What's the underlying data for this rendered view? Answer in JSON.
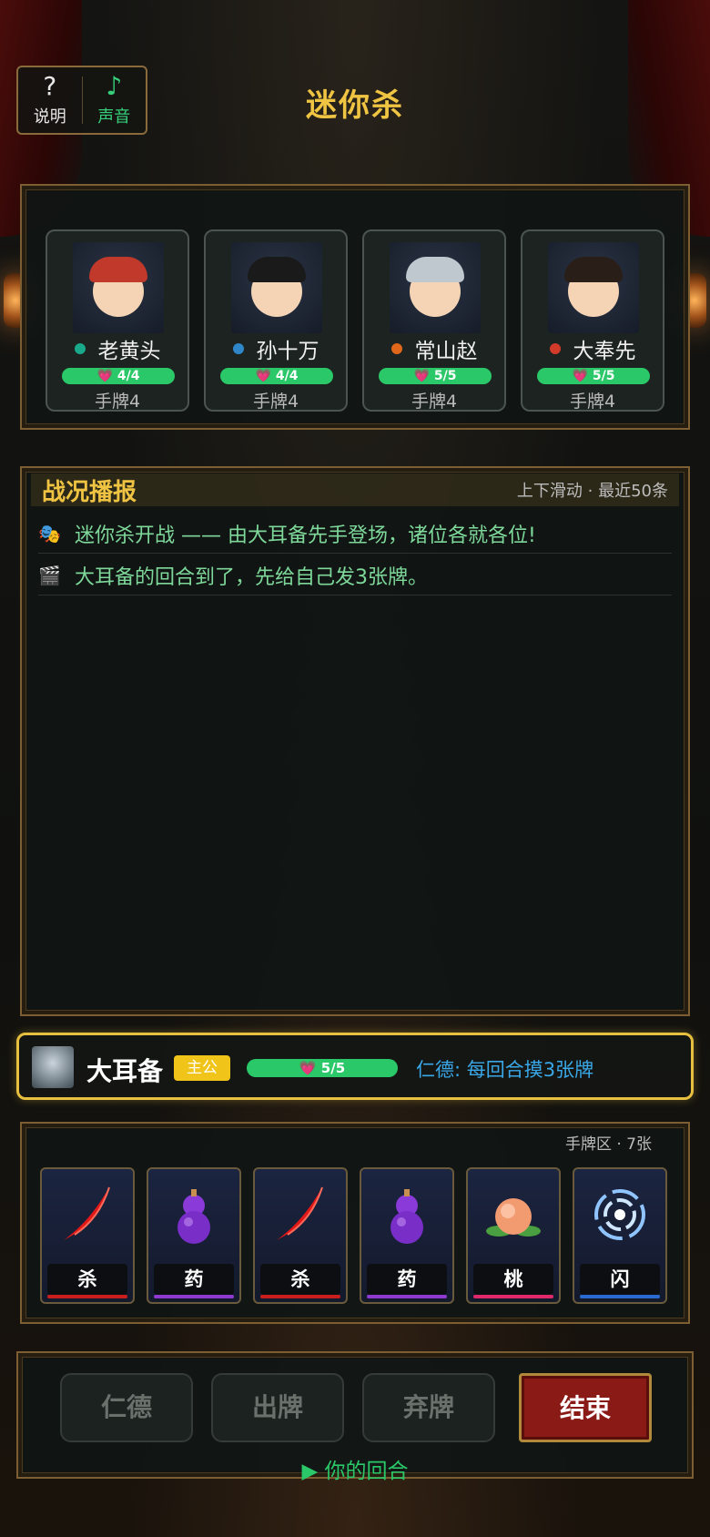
{
  "top_bar": {
    "help": {
      "icon": "?",
      "label": "说明"
    },
    "sound": {
      "icon": "♪",
      "label": "声音"
    }
  },
  "title": "迷你杀",
  "players": [
    {
      "name": "老黄头",
      "dot_color": "#1aa88a",
      "hp": "4/4",
      "hand": "手牌4",
      "hair": "#c0392b"
    },
    {
      "name": "孙十万",
      "dot_color": "#2f86c8",
      "hp": "4/4",
      "hand": "手牌4",
      "hair": "#1a1a1a"
    },
    {
      "name": "常山赵",
      "dot_color": "#e0671a",
      "hp": "5/5",
      "hand": "手牌4",
      "hair": "#bfc7cf"
    },
    {
      "name": "大奉先",
      "dot_color": "#d23a2a",
      "hp": "5/5",
      "hand": "手牌4",
      "hair": "#2a1e18"
    }
  ],
  "hp_icon": "💗",
  "log": {
    "title": "战况播报",
    "hint": "上下滑动 · 最近50条",
    "entries": [
      {
        "icon": "🎭",
        "text": "迷你杀开战 —— 由大耳备先手登场，诸位各就各位!"
      },
      {
        "icon": "🎬",
        "text": "大耳备的回合到了，先给自己发3张牌。"
      }
    ]
  },
  "me": {
    "name": "大耳备",
    "badge": "主公",
    "hp": "5/5",
    "skill": "仁德: 每回合摸3张牌"
  },
  "hand": {
    "count_label": "手牌区 · 7张",
    "cards": [
      {
        "label": "杀",
        "stripe": "#c81e1e",
        "art": "slash"
      },
      {
        "label": "药",
        "stripe": "#8e3ad0",
        "art": "gourd"
      },
      {
        "label": "杀",
        "stripe": "#c81e1e",
        "art": "slash"
      },
      {
        "label": "药",
        "stripe": "#8e3ad0",
        "art": "gourd"
      },
      {
        "label": "桃",
        "stripe": "#e0286a",
        "art": "peach"
      },
      {
        "label": "闪",
        "stripe": "#2a6ad0",
        "art": "swirl"
      }
    ]
  },
  "actions": {
    "rende": "仁德",
    "play": "出牌",
    "discard": "弃牌",
    "end": "结束"
  },
  "turn_label": "▶ 你的回合"
}
